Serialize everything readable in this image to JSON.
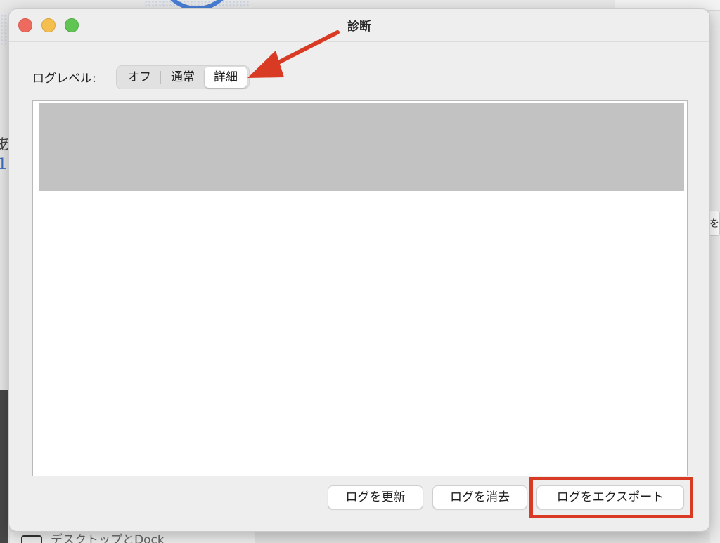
{
  "window": {
    "title": "診断"
  },
  "log_level": {
    "label": "ログレベル:",
    "options": [
      "オフ",
      "通常",
      "詳細"
    ],
    "selected": "詳細"
  },
  "buttons": {
    "refresh": "ログを更新",
    "clear": "ログを消去",
    "export": "ログをエクスポート"
  },
  "background": {
    "dock_item_label": "デスクトップとDock",
    "left_glyph_a": "あ",
    "left_glyph_b": "1",
    "right_chip_text": "を"
  },
  "colors": {
    "annotation_red": "#d83a23",
    "close_button": "#ed6a5e",
    "minimize_button": "#f5bf4f",
    "zoom_button": "#61c554",
    "selection_gray": "#c2c2c2"
  },
  "icons": {
    "close": "close-dot-icon",
    "minimize": "minimize-dot-icon",
    "zoom": "zoom-dot-icon",
    "annotation": "red-arrow-icon"
  }
}
